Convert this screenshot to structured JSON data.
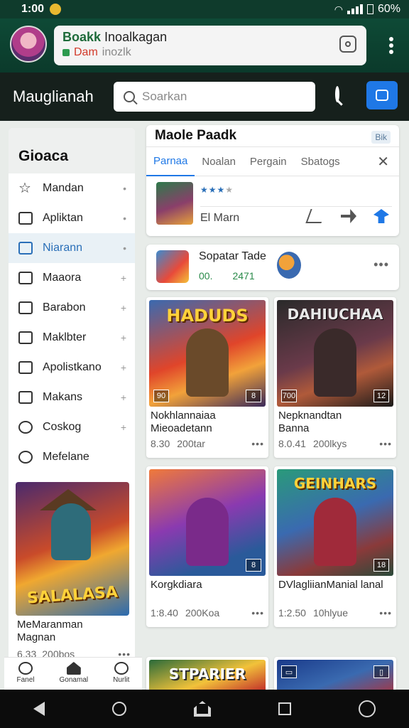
{
  "status_bar": {
    "time": "1:00",
    "battery": "60%"
  },
  "notification": {
    "title_green": "Boakk",
    "title_rest": "Inoalkagan",
    "sub_red": "Dam",
    "sub_muted": "inozlk"
  },
  "app_bar": {
    "title": "Mauglianah",
    "search_placeholder": "Soarkan"
  },
  "sidebar": {
    "title": "Gioaca",
    "items": [
      {
        "label": "Mandan",
        "icon": "star-icon"
      },
      {
        "label": "Apliktan",
        "icon": "list-icon"
      },
      {
        "label": "Niarann",
        "icon": "chart-icon",
        "active": true
      },
      {
        "label": "Maaora",
        "icon": "face-icon"
      },
      {
        "label": "Barabon",
        "icon": "door-icon"
      },
      {
        "label": "Maklbter",
        "icon": "tv-icon"
      },
      {
        "label": "Apolistkano",
        "icon": "house-icon"
      },
      {
        "label": "Makans",
        "icon": "folder-icon"
      },
      {
        "label": "Coskog",
        "icon": "coin-icon"
      },
      {
        "label": "Mefelane",
        "icon": "search-icon"
      }
    ],
    "card": {
      "art_title": "SALALASA",
      "title_line1": "MeMaranman",
      "title_line2": "Magnan",
      "rating": "6.33",
      "downloads": "200bos"
    },
    "bottom_tabs": [
      {
        "label": "Fanel",
        "icon": "profile-icon"
      },
      {
        "label": "Gonamal",
        "icon": "home-icon"
      },
      {
        "label": "Nurlit",
        "icon": "settings-icon"
      }
    ]
  },
  "main_panel": {
    "title": "Maole  Paadk",
    "badge": "Bik",
    "tabs": [
      "Parnaa",
      "Noalan",
      "Pergain",
      "Sbatogs"
    ],
    "active_tab": 0,
    "app_name": "El Marn",
    "rating_stars_filled": 3,
    "rating_stars_total": 5
  },
  "promo": {
    "title": "Sopatar Tade",
    "meta_left": "00.",
    "meta_right": "2471"
  },
  "cards": [
    {
      "art_title": "HADUDS",
      "corner_left": "90",
      "corner_right": "8",
      "line1": "Nokhlannaiaa",
      "line2": "Mieoadetann",
      "rating": "8.30",
      "downloads": "200tar"
    },
    {
      "art_title": "DAHIUCHAA",
      "corner_left": "700",
      "corner_right": "12",
      "line1": "Nepknandtan",
      "line2": "Banna",
      "rating": "8.0.41",
      "downloads": "200lkys"
    },
    {
      "art_title": "",
      "corner_left": "",
      "corner_right": "8",
      "line1": "Korgkdiara",
      "line2": "",
      "rating": "1:8.40",
      "downloads": "200Koa"
    },
    {
      "art_title": "GEINHARS",
      "corner_left": "",
      "corner_right": "18",
      "line1": "DVlagliianManial lanal",
      "line2": "",
      "rating": "1:2.50",
      "downloads": "10hlyue"
    },
    {
      "art_title": "STPARIER",
      "corner_left": "",
      "corner_right": "",
      "line1": "",
      "line2": "",
      "rating": "",
      "downloads": ""
    },
    {
      "art_title": "",
      "corner_left": "",
      "corner_right": "",
      "line1": "",
      "line2": "",
      "rating": "",
      "downloads": ""
    }
  ]
}
